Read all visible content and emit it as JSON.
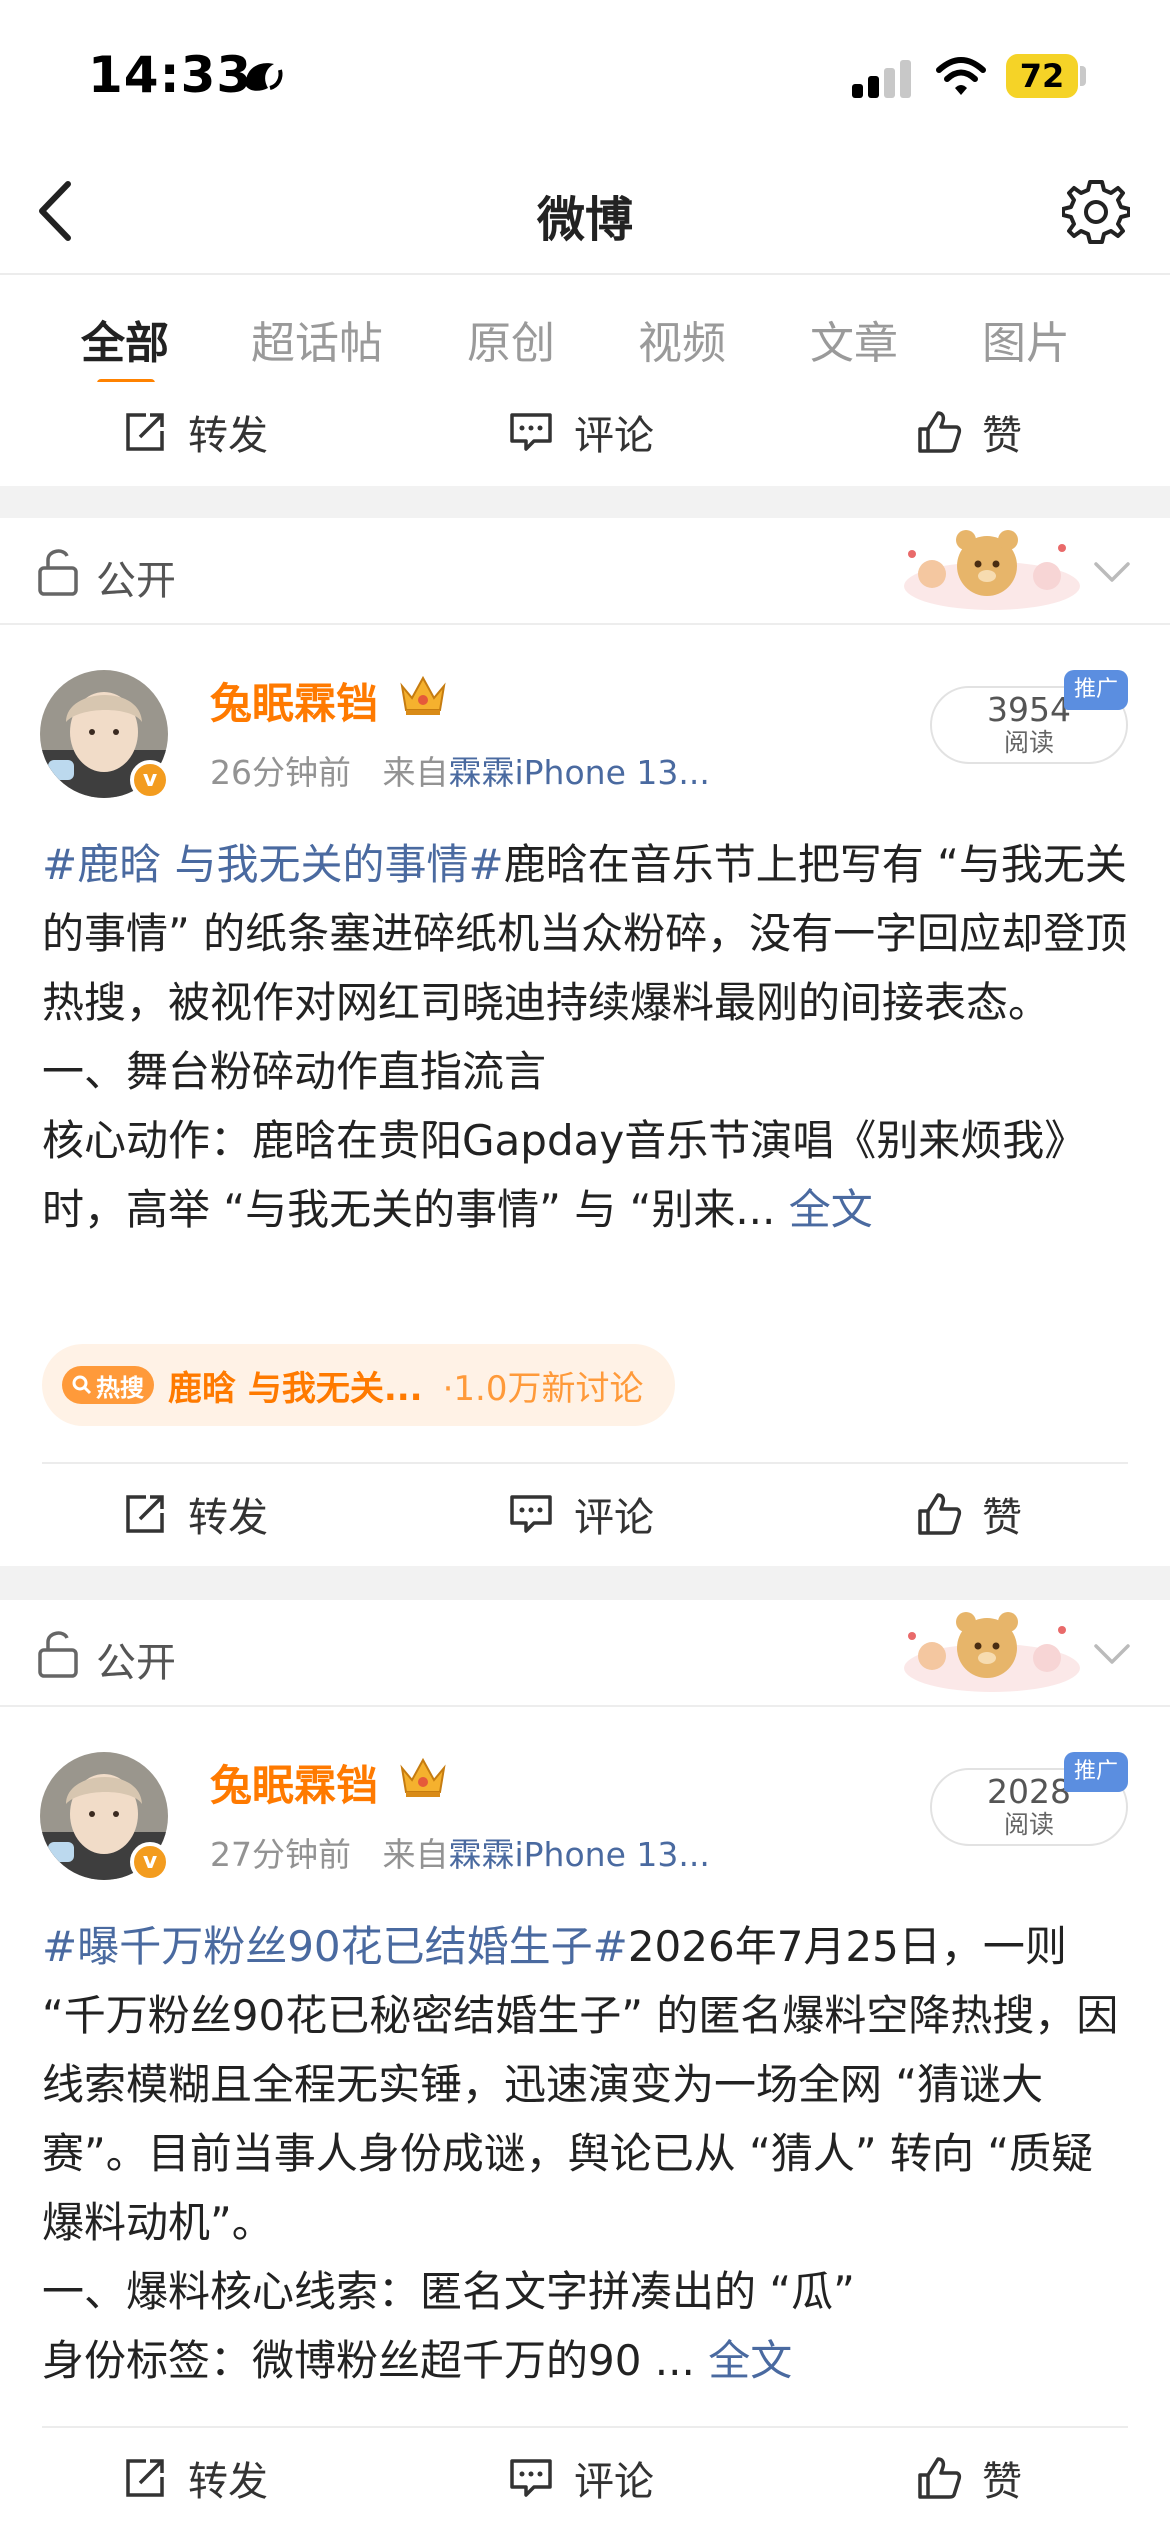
{
  "status_bar": {
    "time": "14:33",
    "battery": "72"
  },
  "nav": {
    "title": "微博"
  },
  "tabs": [
    {
      "label": "全部"
    },
    {
      "label": "超话帖"
    },
    {
      "label": "原创"
    },
    {
      "label": "视频"
    },
    {
      "label": "文章"
    },
    {
      "label": "图片"
    }
  ],
  "actions": {
    "repost": "转发",
    "comment": "评论",
    "like": "赞"
  },
  "posts": [
    {
      "privacy": "公开",
      "username": "兔眠霖铛",
      "time": "26分钟前",
      "source_prefix": "来自",
      "source": "霖霖iPhone 13...",
      "read_count": "3954",
      "read_label": "阅读",
      "promo": "推广",
      "topic": "#鹿晗 与我无关的事情#",
      "text": "鹿晗在音乐节上把写有 “与我无关的事情” 的纸条塞进碎纸机当众粉碎，没有一字回应却登顶热搜，被视作对网红司晓迪持续爆料最刚的间接表态。",
      "line2": "一、舞台粉碎动作直指流言",
      "line3": "核心动作：鹿晗在贵阳Gapday音乐节演唱《别来烦我》时，高举 “与我无关的事情” 与 “别来...",
      "more": "全文",
      "hot_tag": "热搜",
      "hot_keyword": "鹿晗 与我无关...",
      "hot_count": "·1.0万新讨论"
    },
    {
      "privacy": "公开",
      "username": "兔眠霖铛",
      "time": "27分钟前",
      "source_prefix": "来自",
      "source": "霖霖iPhone 13...",
      "read_count": "2028",
      "read_label": "阅读",
      "promo": "推广",
      "topic": "#曝千万粉丝90花已结婚生子#",
      "text": "2026年7月25日，一则 “千万粉丝90花已秘密结婚生子” 的匿名爆料空降热搜，因线索模糊且全程无实锤，迅速演变为一场全网 “猜谜大赛”。目前当事人身份成谜，舆论已从 “猜人” 转向 “质疑爆料动机”。",
      "line2": "一、爆料核心线索：匿名文字拼凑出的 “瓜”",
      "line3": "身份标签：微博粉丝超千万的90 ...",
      "more": "全文"
    }
  ]
}
